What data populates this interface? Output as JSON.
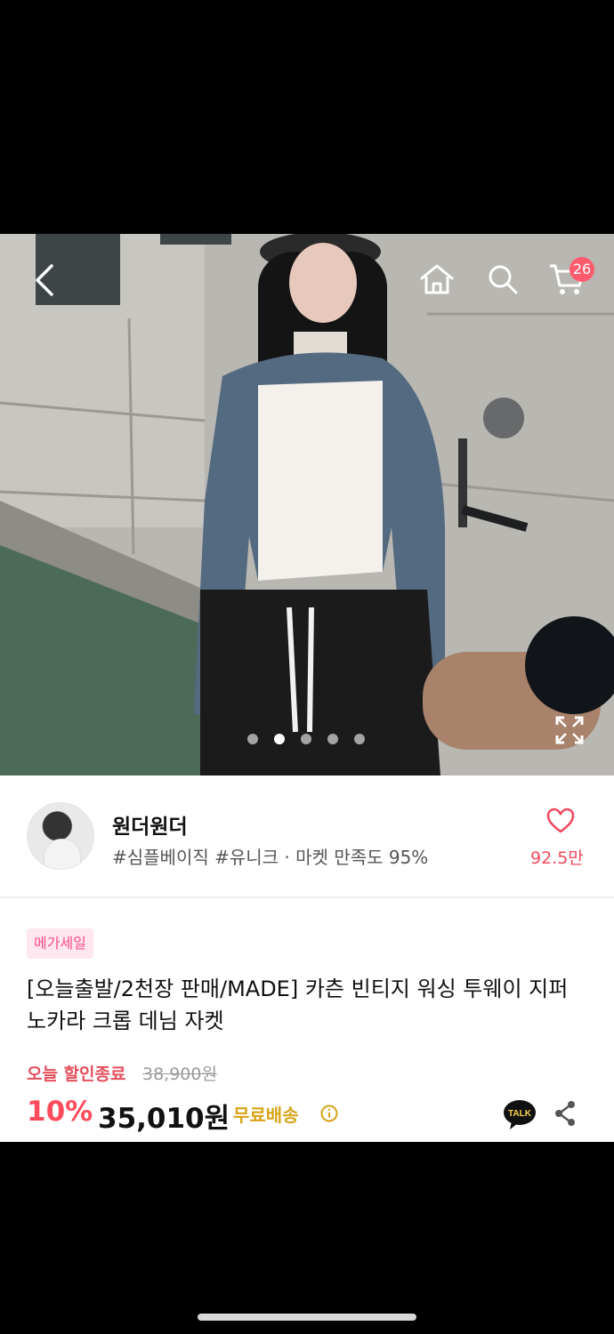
{
  "product_image": {
    "slide_count": 5,
    "active_slide": 2
  },
  "top_nav": {
    "cart_count": "26"
  },
  "shop": {
    "name": "원더원더",
    "tags": "#심플베이직 #유니크 · 마켓 만족도 95%",
    "likes": "92.5만"
  },
  "product": {
    "badge": "메가세일",
    "title": "[오늘출발/2천장 판매/MADE] 카츤 빈티지 워싱 투웨이 지퍼 노카라 크롭 데님 자켓",
    "today_label": "오늘 할인종료",
    "original_price": "38,900원",
    "discount": "10%",
    "price": "35,010원",
    "shipping": "무료배송",
    "talk_label": "TALK"
  },
  "colors": {
    "accent": "#ff4b5c",
    "shipping": "#d8a316",
    "badge_bg": "#ffe7ef",
    "badge_text": "#ff4d89"
  }
}
